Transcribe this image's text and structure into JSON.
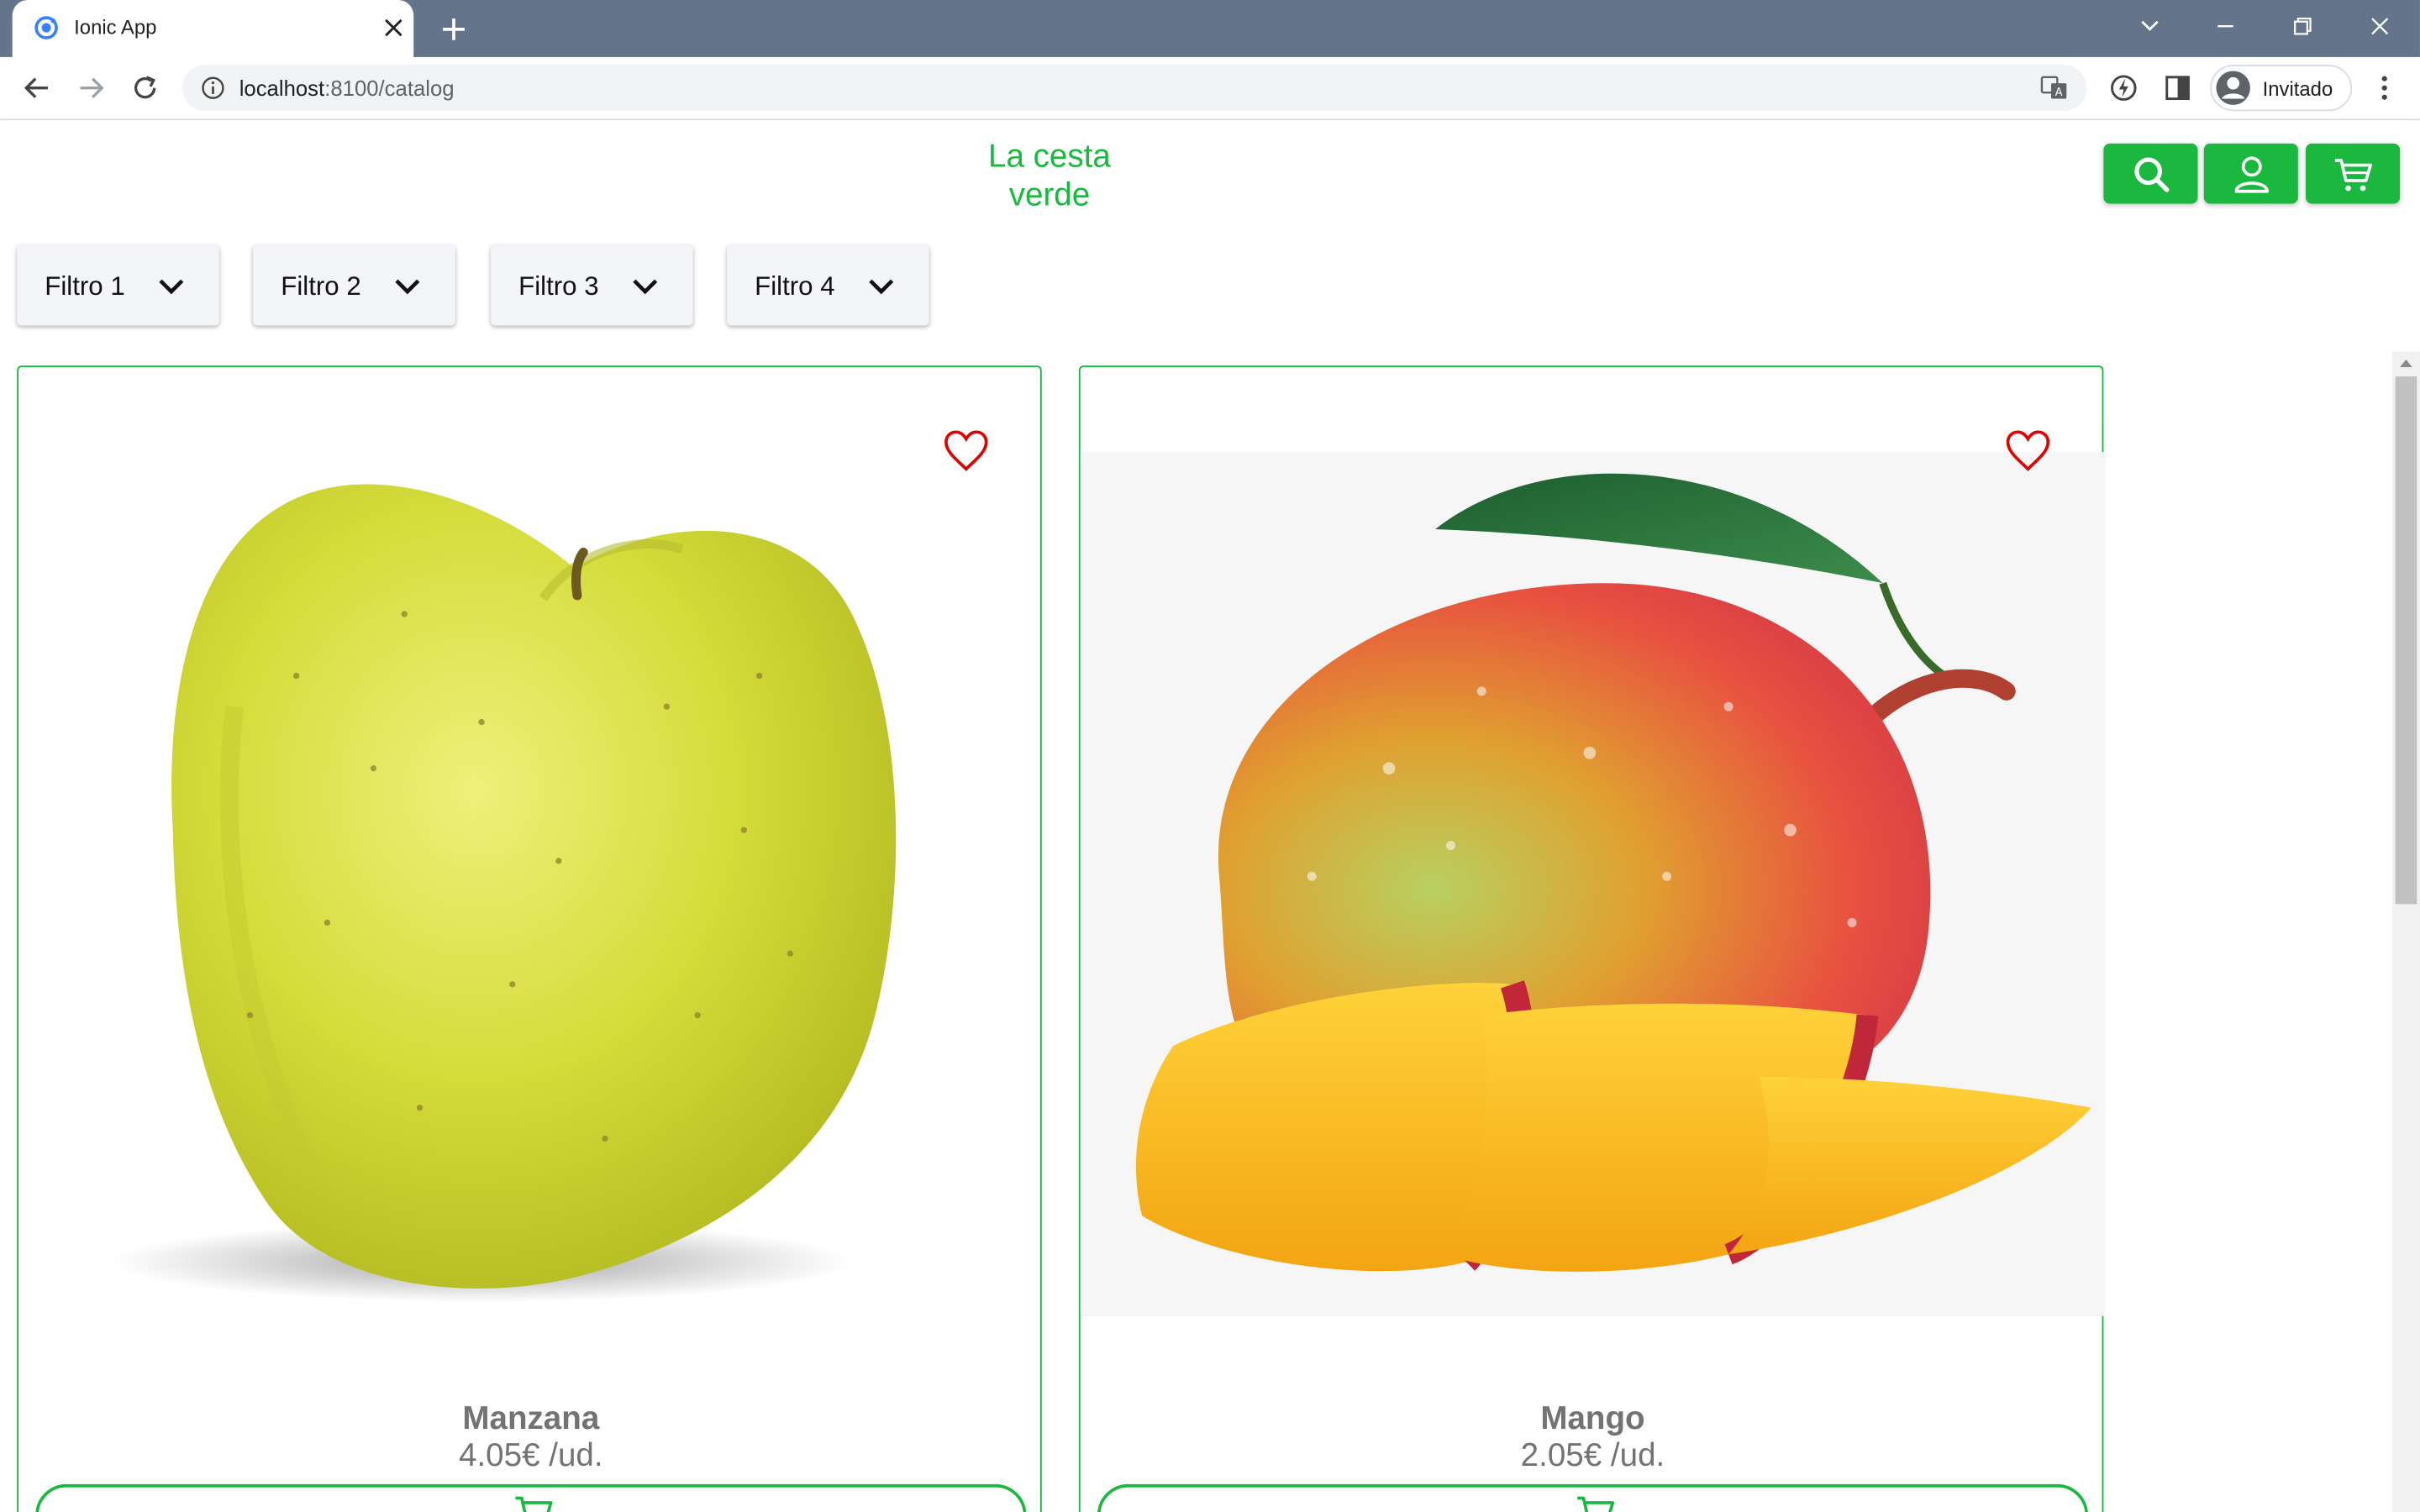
{
  "browser": {
    "tab_title": "Ionic App",
    "url_host": "localhost",
    "url_rest": ":8100/catalog",
    "profile_name": "Invitado"
  },
  "app": {
    "brand_line1": "La cesta",
    "brand_line2": "verde",
    "brand_color": "#1bb840",
    "header_buttons": [
      "search-icon",
      "user-icon",
      "cart-icon"
    ],
    "filters": [
      "Filtro 1",
      "Filtro 2",
      "Filtro 3",
      "Filtro 4"
    ]
  },
  "products": [
    {
      "name": "Manzana",
      "price": "4.05€ /ud.",
      "image": "green apple",
      "favorite": false
    },
    {
      "name": "Mango",
      "price": "2.05€ /ud.",
      "image": "mango with slices",
      "favorite": false
    }
  ]
}
